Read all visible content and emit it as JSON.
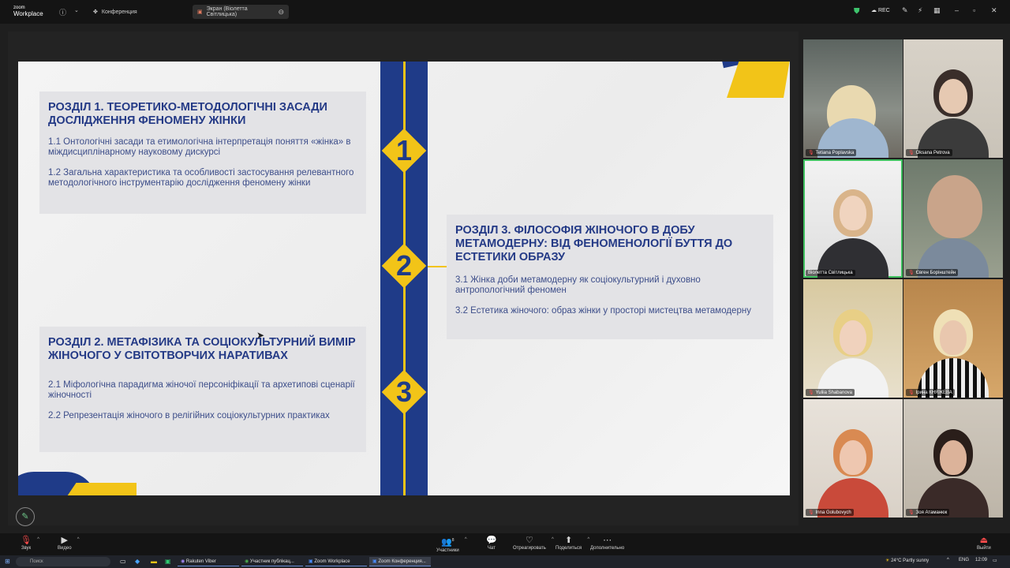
{
  "app": {
    "logo_line1": "zoom",
    "logo_line2": "Workplace"
  },
  "tabs": [
    {
      "label": "Конференция"
    },
    {
      "label": "Экран (Віолетта Світлицька)"
    }
  ],
  "titlebar": {
    "rec_label": "REC"
  },
  "slide": {
    "numbers": [
      "1",
      "2",
      "3"
    ],
    "section1": {
      "title": "РОЗДІЛ 1. ТЕОРЕТИКО-МЕТОДОЛОГІЧНІ ЗАСАДИ ДОСЛІДЖЕННЯ ФЕНОМЕНУ ЖІНКИ",
      "items": [
        "1.1 Онтологічні засади та етимологічна інтерпретація поняття «жінка» в міждисциплінарному науковому дискурсі",
        "1.2 Загальна характеристика та особливості застосування релевантного методологічного інструментарію дослідження феномену жінки"
      ]
    },
    "section2": {
      "title": "РОЗДІЛ 2.  МЕТАФІЗИКА ТА СОЦІОКУЛЬТУРНИЙ ВИМІР ЖІНОЧОГО У СВІТОТВОРЧИХ НАРАТИВАХ",
      "items": [
        "2.1 Міфологічна парадигма жіночої персоніфікації та архетипові сценарії жіночності",
        "2.2 Репрезентація жіночого в релігійних соціокультурних практиках"
      ]
    },
    "section3": {
      "title": "РОЗДІЛ 3. ФІЛОСОФІЯ ЖІНОЧОГО В ДОБУ МЕТАМОДЕРНУ: ВІД ФЕНОМЕНОЛОГІЇ БУТТЯ ДО ЕСТЕТИКИ ОБРАЗУ",
      "items": [
        "3.1 Жінка доби метамодерну як соціокультурний і духовно антропологічний феномен",
        "3.2 Естетика жіночого: образ жінки у просторі мистецтва метамодерну"
      ]
    }
  },
  "participants": [
    {
      "name": "Tetiana Poplavska"
    },
    {
      "name": "Oksana Petrova"
    },
    {
      "name": "Віолетта Світлицька"
    },
    {
      "name": "Євген Борінштейн"
    },
    {
      "name": "Yuliia Shabanova"
    },
    {
      "name": "Ірина КНЯЖЕВА"
    },
    {
      "name": "Inna Golubovych"
    },
    {
      "name": "Зоя Атаманюк"
    }
  ],
  "toolbar": {
    "audio": "Звук",
    "video": "Видео",
    "participants": "Участники",
    "participants_count": "8",
    "chat": "Чат",
    "react": "Отреагировать",
    "share": "Поделиться",
    "more": "Дополнительно",
    "leave": "Выйти"
  },
  "taskbar": {
    "search_placeholder": "Поиск",
    "tasks": [
      "Rakuten Viber",
      "Участник публікац...",
      "Zoom Workplace",
      "Zoom Конференция..."
    ],
    "weather": "24°C  Partly sunny",
    "lang": "ENG",
    "time": "12:09"
  },
  "colors": {
    "accent_yellow": "#f2c418",
    "accent_blue": "#1f3b88",
    "speaker_outline": "#3fc05f"
  }
}
